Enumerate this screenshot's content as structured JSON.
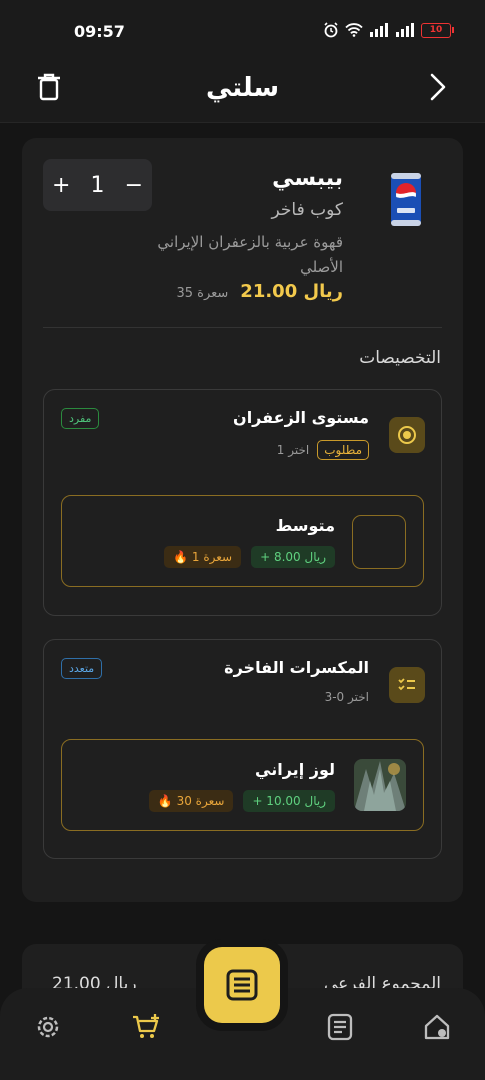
{
  "status_bar": {
    "time": "09:57",
    "battery": "10"
  },
  "header": {
    "title": "سلتي"
  },
  "product": {
    "name": "بيبسي",
    "subtitle": "كوب فاخر",
    "description": "قهوة عربية بالزعفران الإيراني الأصلي",
    "price": "21.00 ريال",
    "calories": "35 سعرة",
    "quantity": "1",
    "minus_label": "−",
    "plus_label": "+"
  },
  "customizations": {
    "title": "التخصيصات",
    "groups": [
      {
        "title": "مستوى الزعفران",
        "choose": "اختر 1",
        "required": "مطلوب",
        "type_badge": "مفرد",
        "options": [
          {
            "name": "متوسط",
            "price": "+ 8.00 ريال",
            "calories": "1 سعرة"
          }
        ]
      },
      {
        "title": "المكسرات الفاخرة",
        "choose": "اختر 0-3",
        "type_badge": "متعدد",
        "options": [
          {
            "name": "لوز إيراني",
            "price": "+ 10.00 ريال",
            "calories": "30 سعرة"
          }
        ]
      }
    ]
  },
  "summary": {
    "label": "المجموع الفرعي",
    "value": "21.00 ريال"
  },
  "colors": {
    "accent": "#ecc94b",
    "price": "#f2c94c",
    "background": "#151515",
    "card": "#1f1f1f"
  },
  "nav": {
    "items": [
      "gear-icon",
      "cart-plus-icon",
      "menu-icon",
      "checklist-icon",
      "home-icon"
    ]
  }
}
